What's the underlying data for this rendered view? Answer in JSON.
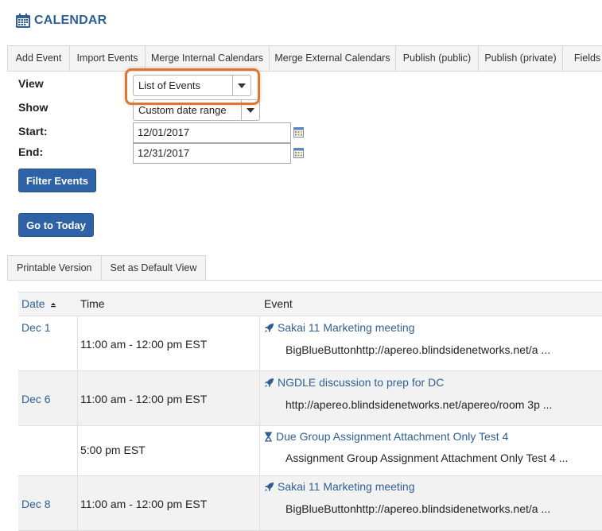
{
  "page": {
    "title": "CALENDAR",
    "icon": "calendar-icon"
  },
  "toolbar": {
    "tabs": [
      "Add Event",
      "Import Events",
      "Merge Internal Calendars",
      "Merge External Calendars",
      "Publish (public)",
      "Publish (private)",
      "Fields"
    ]
  },
  "filter": {
    "view_label": "View",
    "view_value": "List of Events",
    "show_label": "Show",
    "show_value": "Custom date range",
    "start_label": "Start:",
    "start_value": "12/01/2017",
    "end_label": "End:",
    "end_value": "12/31/2017",
    "filter_button": "Filter Events",
    "today_button": "Go to Today"
  },
  "subtabs": [
    "Printable Version",
    "Set as Default View"
  ],
  "table": {
    "headers": {
      "date": "Date",
      "time": "Time",
      "event": "Event"
    },
    "rows": [
      {
        "date": "Dec 1",
        "time": "11:00 am - 12:00 pm EST",
        "icon": "rocket-icon",
        "title": "Sakai 11 Marketing meeting",
        "desc": "BigBlueButtonhttp://apereo.blindsidenetworks.net/a ..."
      },
      {
        "date": "Dec 6",
        "time": "11:00 am - 12:00 pm EST",
        "icon": "rocket-icon",
        "title": "NGDLE discussion to prep for DC",
        "desc": "http://apereo.blindsidenetworks.net/apereo/room 3p ..."
      },
      {
        "date": "",
        "time": "5:00 pm EST",
        "icon": "hourglass-icon",
        "title": "Due Group Assignment Attachment Only Test 4",
        "desc": "Assignment Group Assignment Attachment Only Test 4 ..."
      },
      {
        "date": "Dec 8",
        "time": "11:00 am - 12:00 pm EST",
        "icon": "rocket-icon",
        "title": "Sakai 11 Marketing meeting",
        "desc": "BigBlueButtonhttp://apereo.blindsidenetworks.net/a ..."
      }
    ]
  },
  "colors": {
    "link": "#2f5f95",
    "button": "#2d63a6",
    "highlight": "#d97935"
  }
}
